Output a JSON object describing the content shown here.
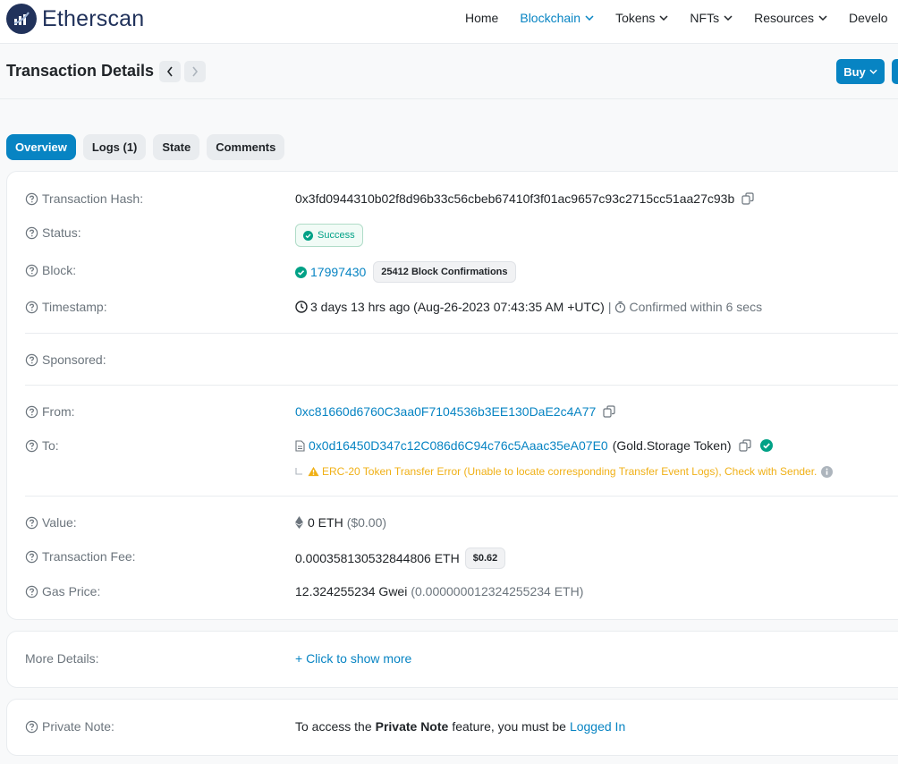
{
  "brand": {
    "name": "Etherscan"
  },
  "nav": {
    "items": [
      {
        "label": "Home"
      },
      {
        "label": "Blockchain"
      },
      {
        "label": "Tokens"
      },
      {
        "label": "NFTs"
      },
      {
        "label": "Resources"
      },
      {
        "label": "Develo"
      }
    ]
  },
  "header": {
    "title": "Transaction Details",
    "buy_label": "Buy"
  },
  "tabs": [
    {
      "label": "Overview"
    },
    {
      "label": "Logs (1)"
    },
    {
      "label": "State"
    },
    {
      "label": "Comments"
    }
  ],
  "details": {
    "tx_hash_label": "Transaction Hash:",
    "tx_hash": "0x3fd0944310b02f8d96b33c56cbeb67410f3f01ac9657c93c2715cc51aa27c93b",
    "status_label": "Status:",
    "status": "Success",
    "block_label": "Block:",
    "block": "17997430",
    "block_confirmations": "25412 Block Confirmations",
    "timestamp_label": "Timestamp:",
    "timestamp_ago": "3 days 13 hrs ago (Aug-26-2023 07:43:35 AM +UTC)",
    "timestamp_sep": "|",
    "confirmed_within": "Confirmed within 6 secs",
    "sponsored_label": "Sponsored:",
    "from_label": "From:",
    "from": "0xc81660d6760C3aa0F7104536b3EE130DaE2c4A77",
    "to_label": "To:",
    "to": "0x0d16450D347c12C086d6C94c76c5Aaac35eA07E0",
    "to_name": "(Gold.Storage Token)",
    "to_warning": "ERC-20 Token Transfer Error (Unable to locate corresponding Transfer Event Logs), Check with Sender.",
    "value_label": "Value:",
    "value": "0 ETH",
    "value_usd": "($0.00)",
    "fee_label": "Transaction Fee:",
    "fee": "0.000358130532844806 ETH",
    "fee_usd": "$0.62",
    "gas_label": "Gas Price:",
    "gas_gwei": "12.324255234 Gwei",
    "gas_eth": "(0.000000012324255234 ETH)"
  },
  "more": {
    "label": "More Details:",
    "link": "+ Click to show more"
  },
  "private_note": {
    "label": "Private Note:",
    "text_before": "To access the",
    "bold": "Private Note",
    "text_mid": "feature, you must be",
    "link": "Logged In"
  },
  "colors": {
    "accent": "#0784c3",
    "brand": "#21325b",
    "success": "#00a186",
    "warning": "#f0b016"
  }
}
